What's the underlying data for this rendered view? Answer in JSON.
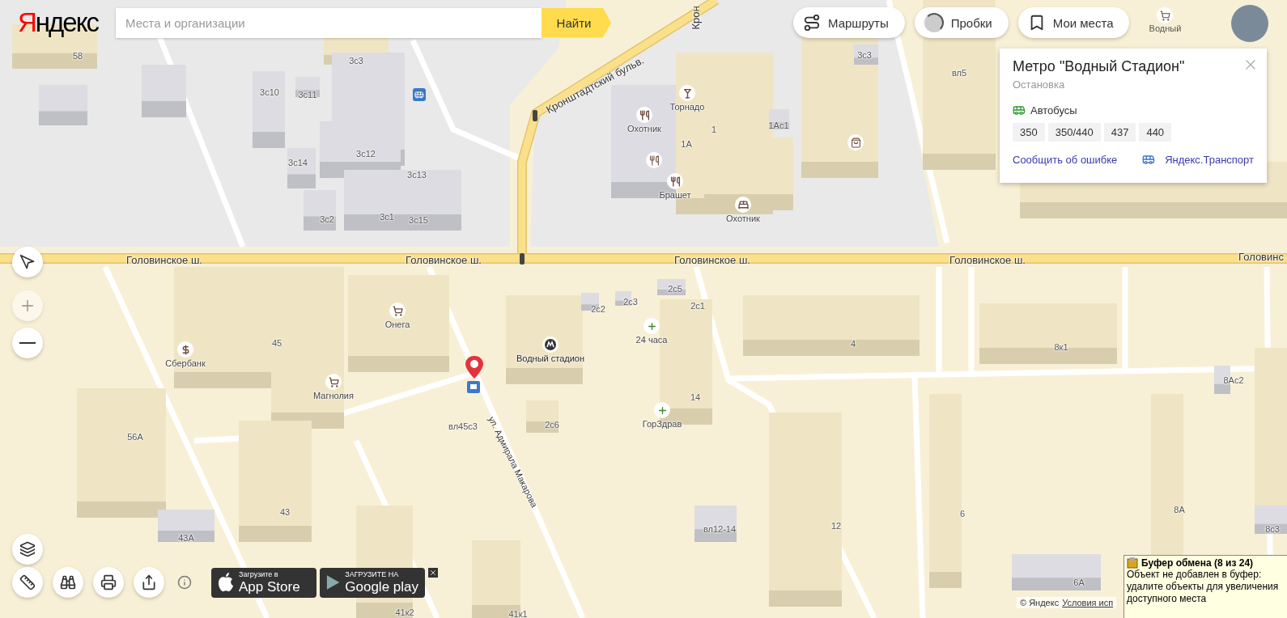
{
  "logo": "Яндекс",
  "search": {
    "placeholder": "Места и организации",
    "button": "Найти"
  },
  "top_buttons": [
    {
      "kind": "routes",
      "label": "Маршруты"
    },
    {
      "kind": "traffic",
      "label": "Пробки",
      "on": false
    },
    {
      "kind": "places",
      "label": "Мои места"
    }
  ],
  "shortcut": {
    "label": "Водный"
  },
  "info_card": {
    "title": "Метро \"Водный Стадион\"",
    "subtitle": "Остановка",
    "transport_type": "Автобусы",
    "routes": [
      "350",
      "350/440",
      "437",
      "440"
    ],
    "report_link": "Сообщить об ошибке",
    "app_link": "Яндекс.Транспорт"
  },
  "map": {
    "streets": [
      "Головинское ш.",
      "Головинское ш.",
      "Головинское ш.",
      "Головинское ш.",
      "Головинс",
      "Кронштадтский бульв.",
      "Крон",
      "ул. Адмирала Макарова"
    ],
    "buildings": [
      "58",
      "3с3",
      "3с10",
      "3с11",
      "3с12",
      "3с14",
      "3с13",
      "3с2",
      "3с1",
      "3с15",
      "1",
      "1А",
      "1Ас1",
      "3с3",
      "вл5",
      "45",
      "56А",
      "43",
      "43А",
      "вл45с3",
      "2с2",
      "2с3",
      "2с5",
      "2с1",
      "2с6",
      "14",
      "4",
      "8к1",
      "8Ас2",
      "вл12-14",
      "12",
      "6",
      "8А",
      "6А",
      "41к2",
      "41к1",
      "8с3"
    ],
    "places": [
      {
        "kind": "bar",
        "label": "Торнадо"
      },
      {
        "kind": "restaurant",
        "label": "Охотник"
      },
      {
        "kind": "restaurant",
        "label": "Брашет"
      },
      {
        "kind": "hotel",
        "label": "Охотник"
      },
      {
        "kind": "shop",
        "label": "Онега"
      },
      {
        "kind": "bank",
        "label": "Сбербанк"
      },
      {
        "kind": "shop",
        "label": "Магнолия"
      },
      {
        "kind": "metro",
        "label": "Водный стадион"
      },
      {
        "kind": "pharmacy",
        "label": "24 часа"
      },
      {
        "kind": "pharmacy",
        "label": "ГорЗдрав"
      }
    ]
  },
  "map_controls": {
    "zoom_in_disabled": true
  },
  "app_badges": [
    {
      "kind": "apple",
      "small": "Загрузите в",
      "big": "App Store"
    },
    {
      "kind": "google",
      "small": "ЗАГРУЗИТЕ НА",
      "big": "Google play"
    }
  ],
  "copyright": {
    "text": "© Яндекс",
    "link": "Условия исп"
  },
  "clipboard_notice": {
    "title": "Буфер обмена (8 из 24)",
    "message": "Объект не добавлен в буфер: удалите объекты для увеличения доступного места"
  }
}
